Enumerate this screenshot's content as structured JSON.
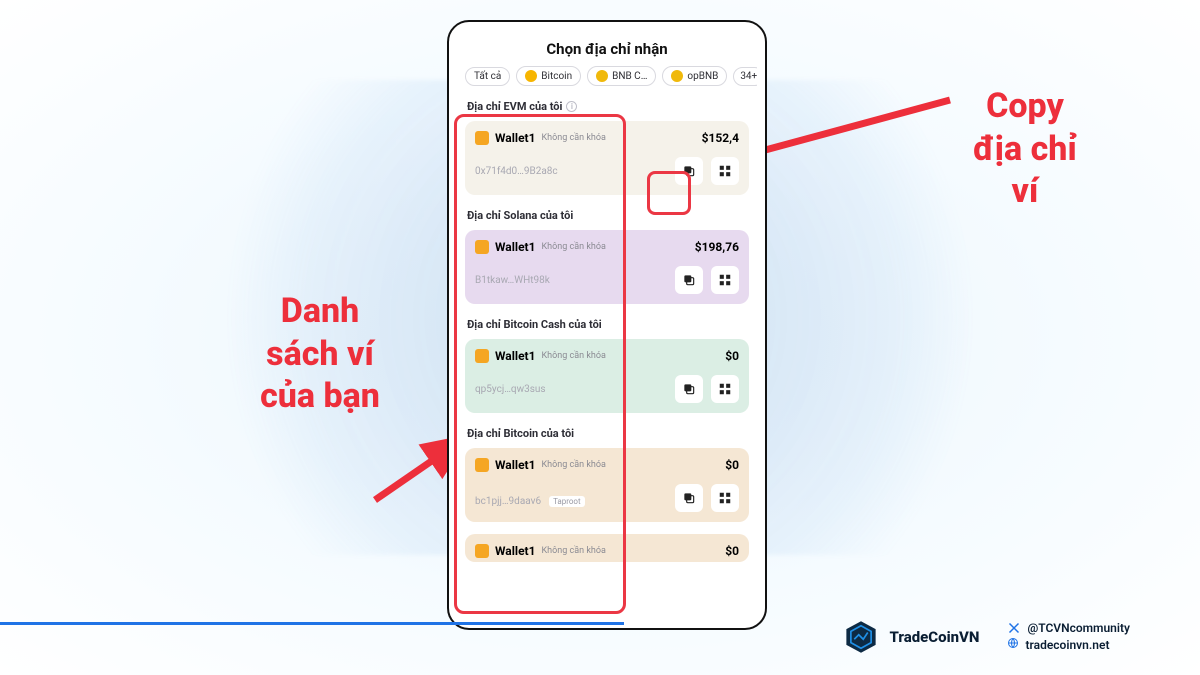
{
  "page": {
    "title": "Chọn địa chỉ nhận"
  },
  "chips": {
    "all": "Tất cả",
    "bitcoin": "Bitcoin",
    "bnb": "BNB C…",
    "opbnb": "opBNB",
    "more": "34+"
  },
  "sections": {
    "evm": {
      "label": "Địa chỉ EVM của tôi",
      "wallets": [
        {
          "name": "Wallet1",
          "sub": "Không cần khóa",
          "amount": "$152,4",
          "address": "0x71f4d0…9B2a8c"
        }
      ]
    },
    "sol": {
      "label": "Địa chỉ Solana của tôi",
      "wallets": [
        {
          "name": "Wallet1",
          "sub": "Không cần khóa",
          "amount": "$198,76",
          "address": "B1tkaw…WHt98k"
        }
      ]
    },
    "bch": {
      "label": "Địa chỉ Bitcoin Cash của tôi",
      "wallets": [
        {
          "name": "Wallet1",
          "sub": "Không cần khóa",
          "amount": "$0",
          "address": "qp5ycj…qw3sus"
        }
      ]
    },
    "btc": {
      "label": "Địa chỉ Bitcoin của tôi",
      "wallets": [
        {
          "name": "Wallet1",
          "sub": "Không cần khóa",
          "amount": "$0",
          "address": "bc1pjj…9daav6",
          "tag": "Taproot"
        },
        {
          "name": "Wallet1",
          "sub": "Không cần khóa",
          "amount": "$0"
        }
      ]
    }
  },
  "annotations": {
    "copy": "Copy địa chỉ ví",
    "list": "Danh sách ví của bạn"
  },
  "footer": {
    "brand": "TradeCoinVN",
    "handle": "@TCVNcommunity",
    "site": "tradecoinvn.net"
  }
}
